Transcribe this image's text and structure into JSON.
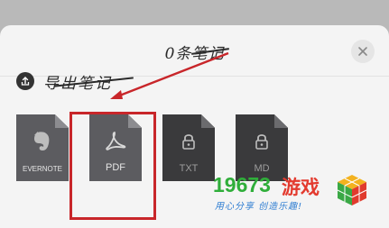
{
  "dialog": {
    "title": "0条笔记",
    "close_label": "×"
  },
  "export_section": {
    "title": "导出笔记"
  },
  "files": [
    {
      "label": "EVERNOTE",
      "icon": "evernote-icon",
      "enabled": true
    },
    {
      "label": "PDF",
      "icon": "pdf-icon",
      "enabled": true
    },
    {
      "label": "TXT",
      "icon": "lock-icon",
      "enabled": false
    },
    {
      "label": "MD",
      "icon": "lock-icon",
      "enabled": false
    }
  ],
  "watermark": {
    "number": "19673",
    "name": "游戏",
    "slogan": "用心分享 创造乐趣!"
  },
  "colors": {
    "highlight": "#c8262a",
    "file_active": "#5c5c60",
    "file_locked": "#3a3a3c"
  }
}
